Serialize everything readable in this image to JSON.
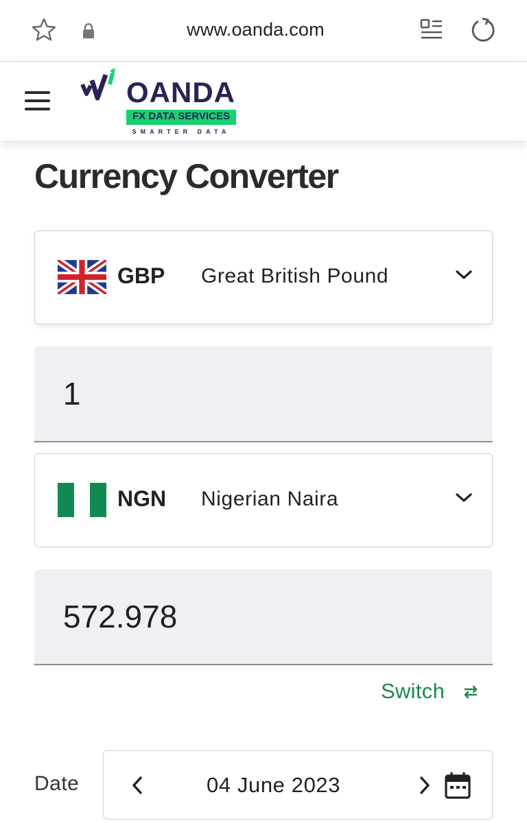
{
  "browser": {
    "url": "www.oanda.com",
    "icons": {
      "bookmark": "star-icon",
      "secure": "lock-icon",
      "reader": "reader-mode-icon",
      "reload": "reload-icon"
    }
  },
  "header": {
    "menu_icon": "hamburger-icon",
    "logo": {
      "brand": "OANDA",
      "tagline": "FX DATA SERVICES",
      "subtagline": "SMARTER DATA"
    },
    "colors": {
      "brand": "#2a2356",
      "accent": "#16d26e"
    }
  },
  "main": {
    "title": "Currency Converter",
    "from": {
      "code": "GBP",
      "name": "Great British Pound",
      "flag": "uk-flag",
      "amount": "1"
    },
    "to": {
      "code": "NGN",
      "name": "Nigerian Naira",
      "flag": "nigeria-flag",
      "amount": "572.978"
    },
    "switch_label": "Switch",
    "switch_color": "#1a8a4c",
    "date": {
      "label": "Date",
      "value": "04 June 2023"
    }
  }
}
